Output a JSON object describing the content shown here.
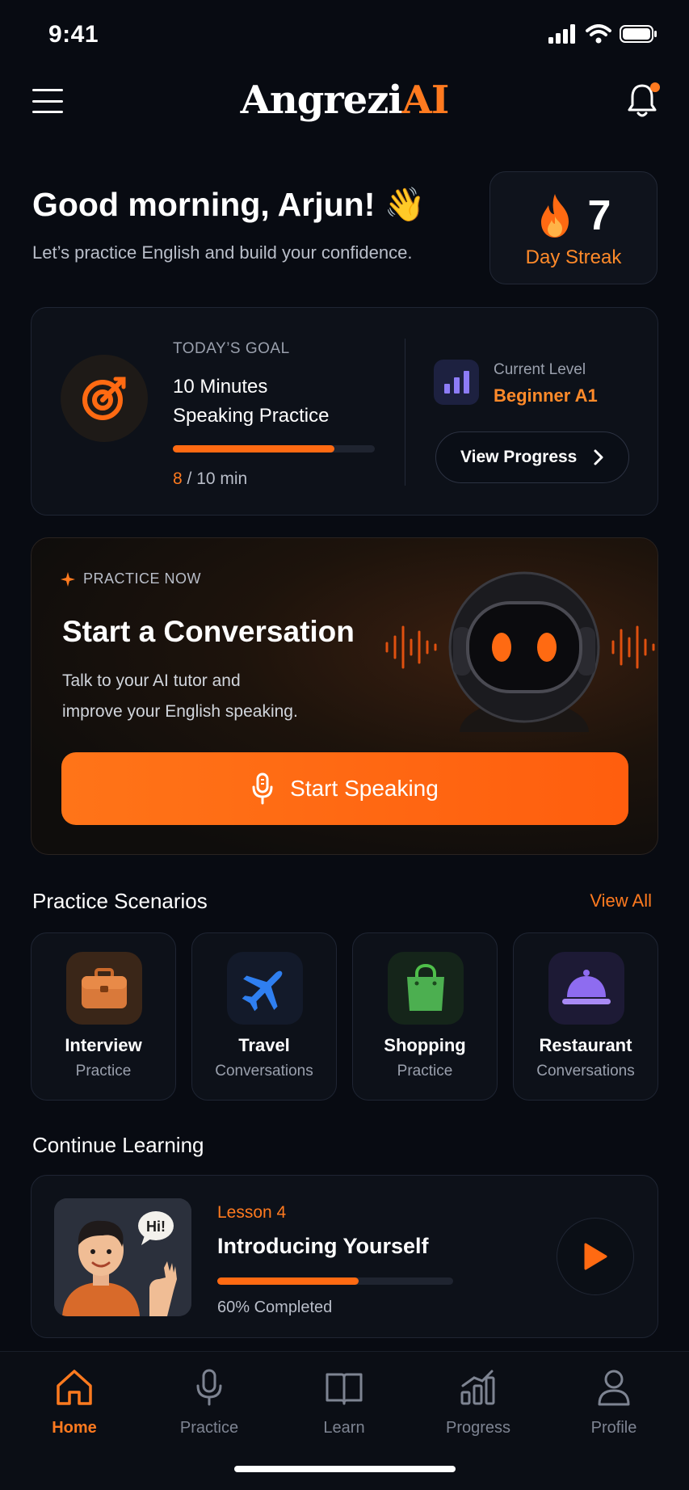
{
  "status": {
    "time": "9:41"
  },
  "header": {
    "logo_main": "Angrezi",
    "logo_accent": "AI"
  },
  "greeting": {
    "title": "Good morning, Arjun! 👋",
    "subtitle": "Let’s practice English and build your confidence."
  },
  "streak": {
    "count": "7",
    "label": "Day Streak"
  },
  "goal": {
    "tag": "TODAY’S GOAL",
    "line1": "10 Minutes",
    "line2": "Speaking Practice",
    "done": "8",
    "rest": " / 10 min",
    "progress": 0.8
  },
  "level": {
    "label": "Current Level",
    "value": "Beginner A1",
    "button": "View Progress"
  },
  "hero": {
    "tag": "PRACTICE NOW",
    "title": "Start a Conversation",
    "desc_line1": "Talk to your AI tutor and",
    "desc_line2": "improve your English speaking.",
    "button": "Start Speaking"
  },
  "scenarios": {
    "title": "Practice Scenarios",
    "view_all": "View All",
    "items": [
      {
        "name": "Interview",
        "sub": "Practice",
        "icon": "briefcase-icon",
        "bg": "#3a2618"
      },
      {
        "name": "Travel",
        "sub": "Conversations",
        "icon": "airplane-icon",
        "bg": "#131a2a"
      },
      {
        "name": "Shopping",
        "sub": "Practice",
        "icon": "shopping-bag-icon",
        "bg": "#15251a"
      },
      {
        "name": "Restaurant",
        "sub": "Conversations",
        "icon": "cloche-icon",
        "bg": "#1d1a35"
      }
    ]
  },
  "continue": {
    "title": "Continue Learning",
    "lesson": "Lesson 4",
    "name": "Introducing Yourself",
    "pct_text": "60% Completed",
    "progress": 0.6,
    "bubble": "Hi!"
  },
  "tabs": [
    {
      "label": "Home",
      "icon": "home-icon",
      "active": true
    },
    {
      "label": "Practice",
      "icon": "microphone-icon",
      "active": false
    },
    {
      "label": "Learn",
      "icon": "book-icon",
      "active": false
    },
    {
      "label": "Progress",
      "icon": "chart-icon",
      "active": false
    },
    {
      "label": "Profile",
      "icon": "user-icon",
      "active": false
    }
  ],
  "colors": {
    "accent": "#ff7a1f",
    "background": "#080b12",
    "card": "#0d1119"
  }
}
